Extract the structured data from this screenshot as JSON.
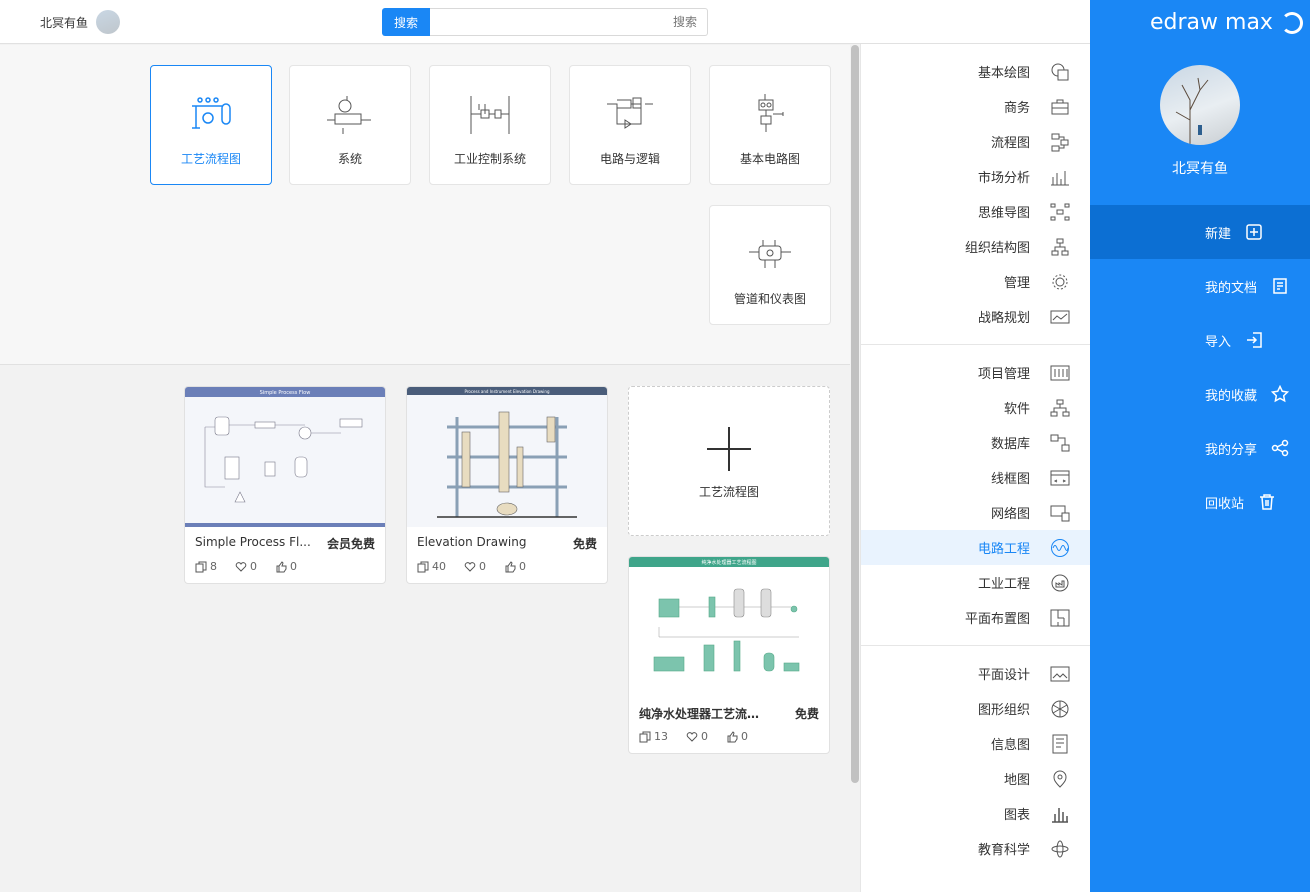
{
  "app": {
    "brand": "edraw max"
  },
  "colors": {
    "accent": "#1a87f5",
    "accent_dark": "#0c6fd3"
  },
  "user": {
    "name": "北冥有鱼"
  },
  "topbar": {
    "search_button": "搜索",
    "search_placeholder": "搜索"
  },
  "nav": [
    {
      "label": "新建",
      "icon": "new-file-icon"
    },
    {
      "label": "我的文档",
      "icon": "documents-icon"
    },
    {
      "label": "导入",
      "icon": "import-icon"
    },
    {
      "label": "我的收藏",
      "icon": "star-icon"
    },
    {
      "label": "我的分享",
      "icon": "share-icon"
    },
    {
      "label": "回收站",
      "icon": "trash-icon"
    }
  ],
  "categories": {
    "group1": [
      "基本绘图",
      "商务",
      "流程图",
      "市场分析",
      "思维导图",
      "组织结构图",
      "管理",
      "战略规划"
    ],
    "group2": [
      "项目管理",
      "软件",
      "数据库",
      "线框图",
      "网络图",
      "电路工程",
      "工业工程",
      "平面布置图"
    ],
    "group3": [
      "平面设计",
      "图形组织",
      "信息图",
      "地图",
      "图表",
      "教育科学"
    ],
    "active": "电路工程"
  },
  "types": [
    {
      "label": "基本电路图"
    },
    {
      "label": "电路与逻辑"
    },
    {
      "label": "工业控制系统"
    },
    {
      "label": "系统"
    },
    {
      "label": "工艺流程图",
      "selected": true
    },
    {
      "label": "管道和仪表图"
    }
  ],
  "new_card": {
    "label": "工艺流程图"
  },
  "templates": [
    {
      "name": "Elevation Drawing",
      "badge": "免费",
      "likes": "0",
      "favs": "0",
      "copies": "40",
      "thumb_title": "Process and Instrument Elevation Drawing"
    },
    {
      "name": "Simple Process Fl...",
      "badge": "会员免费",
      "likes": "0",
      "favs": "0",
      "copies": "8",
      "thumb_title": "Simple Process Flow"
    },
    {
      "name": "纯净水处理器工艺流程图",
      "badge": "免费",
      "likes": "0",
      "favs": "0",
      "copies": "13",
      "thumb_title": "纯净水处理器工艺流程图"
    }
  ]
}
